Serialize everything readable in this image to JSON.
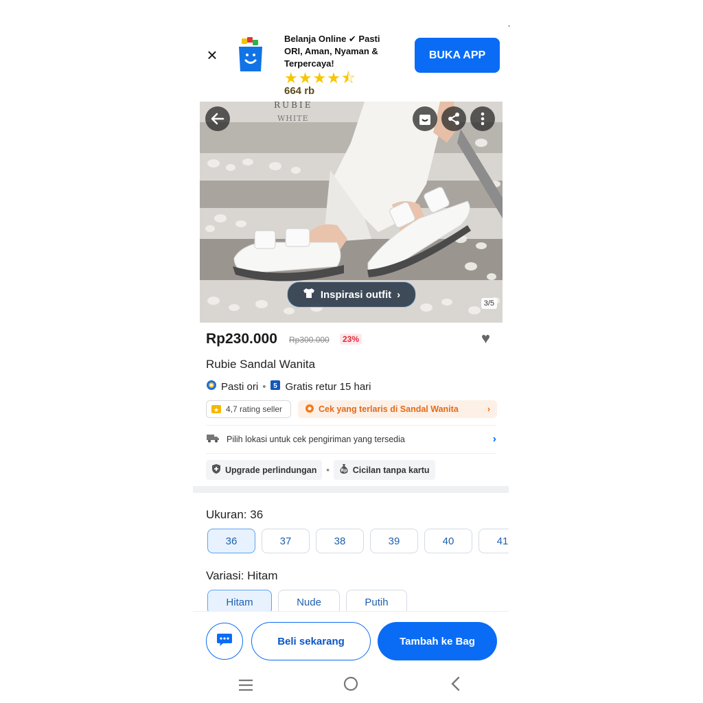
{
  "banner": {
    "close": "×",
    "text": "Belanja Online ✔ Pasti ORI, Aman, Nyaman & Terpercaya!",
    "stars": "★★★★⯪",
    "rating_count": "664 rb",
    "open_app": "BUKA APP"
  },
  "hero": {
    "brand_line1": "RUBIE",
    "brand_line2": "WHITE",
    "outfit_label": "Inspirasi outfit",
    "counter": "3/5"
  },
  "product": {
    "price": "Rp230.000",
    "old_price": "Rp300.000",
    "discount": "23%",
    "name": "Rubie Sandal Wanita",
    "badge_original": "Pasti ori",
    "badge_return": "Gratis retur 15 hari",
    "seller_rating": "4,7 rating seller",
    "best_seller_link": "Cek yang terlaris di Sandal Wanita",
    "shipping": "Pilih lokasi untuk cek pengiriman yang tersedia",
    "protection": "Upgrade perlindungan",
    "installment": "Cicilan tanpa kartu"
  },
  "size": {
    "label": "Ukuran: 36",
    "options": [
      "36",
      "37",
      "38",
      "39",
      "40",
      "41"
    ],
    "selected": "36"
  },
  "variant": {
    "label": "Variasi: Hitam",
    "options": [
      "Hitam",
      "Nude",
      "Putih"
    ],
    "selected": "Hitam"
  },
  "actions": {
    "buy_now": "Beli sekarang",
    "add_to_bag": "Tambah ke Bag"
  },
  "nav": {
    "recent": "☰",
    "home": "○",
    "back": "‹"
  },
  "colors": {
    "accent": "#0a6cf5",
    "discount": "#e02b3b",
    "best_seller": "#e36a1a"
  }
}
